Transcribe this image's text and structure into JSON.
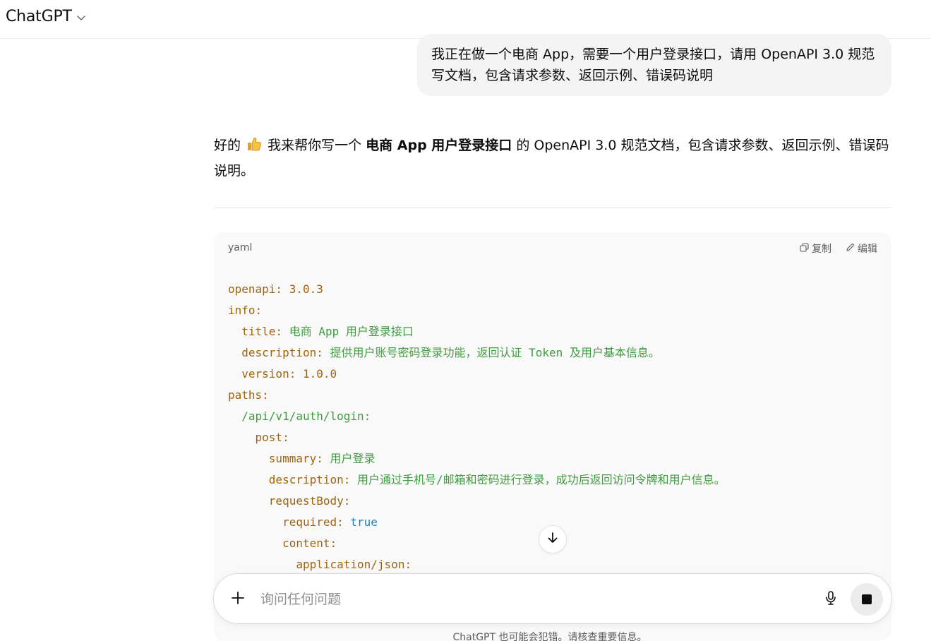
{
  "header": {
    "model_name": "ChatGPT"
  },
  "user_message": {
    "text": "我正在做一个电商 App，需要一个用户登录接口，请用 OpenAPI 3.0 规范写文档，包含请求参数、返回示例、错误码说明"
  },
  "assistant_message": {
    "prefix": "好的",
    "emoji": "thumbs-up",
    "text_before_bold": " 我来帮你写一个 ",
    "bold": "电商 App 用户登录接口",
    "text_after_bold": " 的 OpenAPI 3.0 规范文档，包含请求参数、返回示例、错误码说明。"
  },
  "code_block": {
    "language": "yaml",
    "copy_label": "复制",
    "edit_label": "编辑",
    "lines": [
      {
        "indent": "",
        "key": "openapi:",
        "value": " 3.0.3",
        "value_type": "n"
      },
      {
        "indent": "",
        "key": "info:",
        "value": "",
        "value_type": "s"
      },
      {
        "indent": "  ",
        "key": "title:",
        "value": " 电商 App 用户登录接口",
        "value_type": "s"
      },
      {
        "indent": "  ",
        "key": "description:",
        "value": " 提供用户账号密码登录功能，返回认证 Token 及用户基本信息。",
        "value_type": "s"
      },
      {
        "indent": "  ",
        "key": "version:",
        "value": " 1.0.0",
        "value_type": "n"
      },
      {
        "indent": "",
        "key": "paths:",
        "value": "",
        "value_type": "s"
      },
      {
        "indent": "  ",
        "key": "",
        "value": "/api/v1/auth/login:",
        "value_type": "s"
      },
      {
        "indent": "    ",
        "key": "post:",
        "value": "",
        "value_type": "s"
      },
      {
        "indent": "      ",
        "key": "summary:",
        "value": " 用户登录",
        "value_type": "s"
      },
      {
        "indent": "      ",
        "key": "description:",
        "value": " 用户通过手机号/邮箱和密码进行登录，成功后返回访问令牌和用户信息。",
        "value_type": "s"
      },
      {
        "indent": "      ",
        "key": "requestBody:",
        "value": "",
        "value_type": "s"
      },
      {
        "indent": "        ",
        "key": "required:",
        "value": " true",
        "value_type": "b"
      },
      {
        "indent": "        ",
        "key": "content:",
        "value": "",
        "value_type": "s"
      },
      {
        "indent": "          ",
        "key": "application/json:",
        "value": "",
        "value_type": "s"
      }
    ]
  },
  "composer": {
    "placeholder": "询问任何问题"
  },
  "footer": {
    "disclaimer": "ChatGPT 也可能会犯错。请核查重要信息。"
  }
}
